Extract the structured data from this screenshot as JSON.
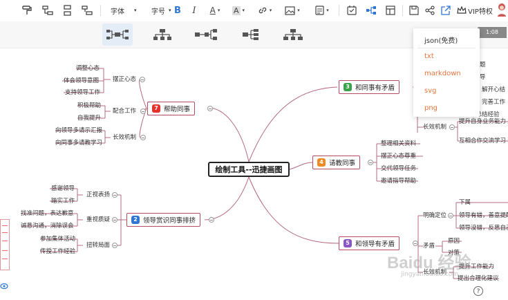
{
  "toolbar": {
    "font_label": "字体",
    "fontsize_label": "字号",
    "vip_label": "VIP特权"
  },
  "export_menu": {
    "items": [
      "json(免费)",
      "txt",
      "markdown",
      "svg",
      "png"
    ],
    "colors": {
      "free": "#333333",
      "paid": "#e8743b"
    }
  },
  "timer": "1:08",
  "central": "绘制工具--迅捷画图",
  "topics": {
    "help": {
      "label": "帮助同事",
      "badge": "7",
      "color": "#e5302c"
    },
    "leader": {
      "label": "领导赏识同事排挤",
      "badge": "2",
      "color": "#2e76d0"
    },
    "conflict": {
      "label": "和同事有矛盾",
      "badge": "3",
      "color": "#38a34a"
    },
    "consult": {
      "label": "请教同事",
      "badge": "4",
      "color": "#ee8a22"
    },
    "boss": {
      "label": "和领导有矛盾",
      "badge": "5",
      "color": "#8a56c6"
    }
  },
  "help_branch": {
    "attitude": "摆正心态",
    "attitude_items": [
      "调整心态",
      "体会领导意图",
      "支持领导工作"
    ],
    "cooperate": "配合工作",
    "cooperate_items": [
      "积极帮助",
      "自我提升"
    ],
    "longterm": "长效机制",
    "longterm_items": [
      "向领导多请示汇报",
      "向同事多请教学习"
    ]
  },
  "leader_branch": {
    "show": "正视表扬",
    "show_items": [
      "感谢领导",
      "踏实工作"
    ],
    "doubt": "重视质疑",
    "doubt_items": [
      "找准问题，表达歉意",
      "诚恳沟通，消除误会"
    ],
    "turn": "扭转局面",
    "turn_items": [
      "参加集体活动",
      "传授工作经验"
    ]
  },
  "consult_items": [
    "整理相关资料",
    "摆正心态尊重",
    "交代领导任务",
    "邀请指导帮助"
  ],
  "conflict_branch": {
    "partial": [
      "题",
      "导",
      "题，解开心结",
      "度，完善工作",
      "的总结经验"
    ],
    "longterm": "长效机制",
    "longterm_items": [
      "提升自身业务能力",
      "互相合作交流学习"
    ]
  },
  "boss_branch": {
    "position": "明确定位",
    "position_items": [
      "下属",
      "领导有错，善意提醒",
      "领导没错，反思自己"
    ],
    "conflict": "矛盾",
    "conflict_items": [
      "原因",
      "对策"
    ],
    "longterm": "长效机制",
    "longterm_items": [
      "提升工作能力",
      "提出合理化建议"
    ]
  },
  "watermark": "Baidu 经验",
  "watermark_sub": "jingyan.baidu.com"
}
